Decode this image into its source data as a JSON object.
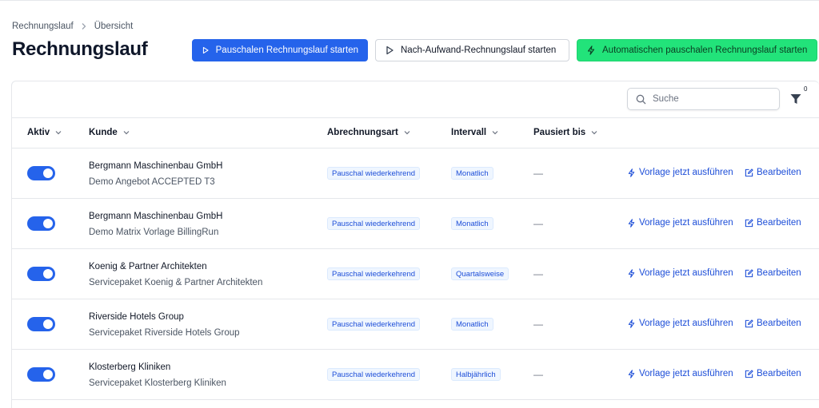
{
  "breadcrumb": {
    "root": "Rechnungslauf",
    "current": "Übersicht"
  },
  "page_title": "Rechnungslauf",
  "actions": {
    "pauschal": "Pauschalen Rechnungslauf starten",
    "aufwand": "Nach-Aufwand-Rechnungslauf starten",
    "auto": "Automatischen pauschalen Rechnungslauf starten"
  },
  "search": {
    "placeholder": "Suche"
  },
  "filter": {
    "count": "0"
  },
  "columns": {
    "aktiv": "Aktiv",
    "kunde": "Kunde",
    "abrechnungsart": "Abrechnungsart",
    "intervall": "Intervall",
    "pausiert": "Pausiert bis"
  },
  "row_actions": {
    "run": "Vorlage jetzt ausführen",
    "edit": "Bearbeiten"
  },
  "rows": [
    {
      "active": true,
      "customer": "Bergmann Maschinenbau GmbH",
      "template": "Demo Angebot ACCEPTED T3",
      "billing_type": "Pauschal wiederkehrend",
      "interval": "Monatlich",
      "paused_until": "—"
    },
    {
      "active": true,
      "customer": "Bergmann Maschinenbau GmbH",
      "template": "Demo Matrix Vorlage BillingRun",
      "billing_type": "Pauschal wiederkehrend",
      "interval": "Monatlich",
      "paused_until": "—"
    },
    {
      "active": true,
      "customer": "Koenig & Partner Architekten",
      "template": "Servicepaket Koenig & Partner Architekten",
      "billing_type": "Pauschal wiederkehrend",
      "interval": "Quartalsweise",
      "paused_until": "—"
    },
    {
      "active": true,
      "customer": "Riverside Hotels Group",
      "template": "Servicepaket Riverside Hotels Group",
      "billing_type": "Pauschal wiederkehrend",
      "interval": "Monatlich",
      "paused_until": "—"
    },
    {
      "active": true,
      "customer": "Klosterberg Kliniken",
      "template": "Servicepaket Klosterberg Kliniken",
      "billing_type": "Pauschal wiederkehrend",
      "interval": "Halbjährlich",
      "paused_until": "—"
    }
  ],
  "colors": {
    "primary": "#2563eb",
    "green": "#22e37a",
    "link": "#1d4ed8"
  }
}
